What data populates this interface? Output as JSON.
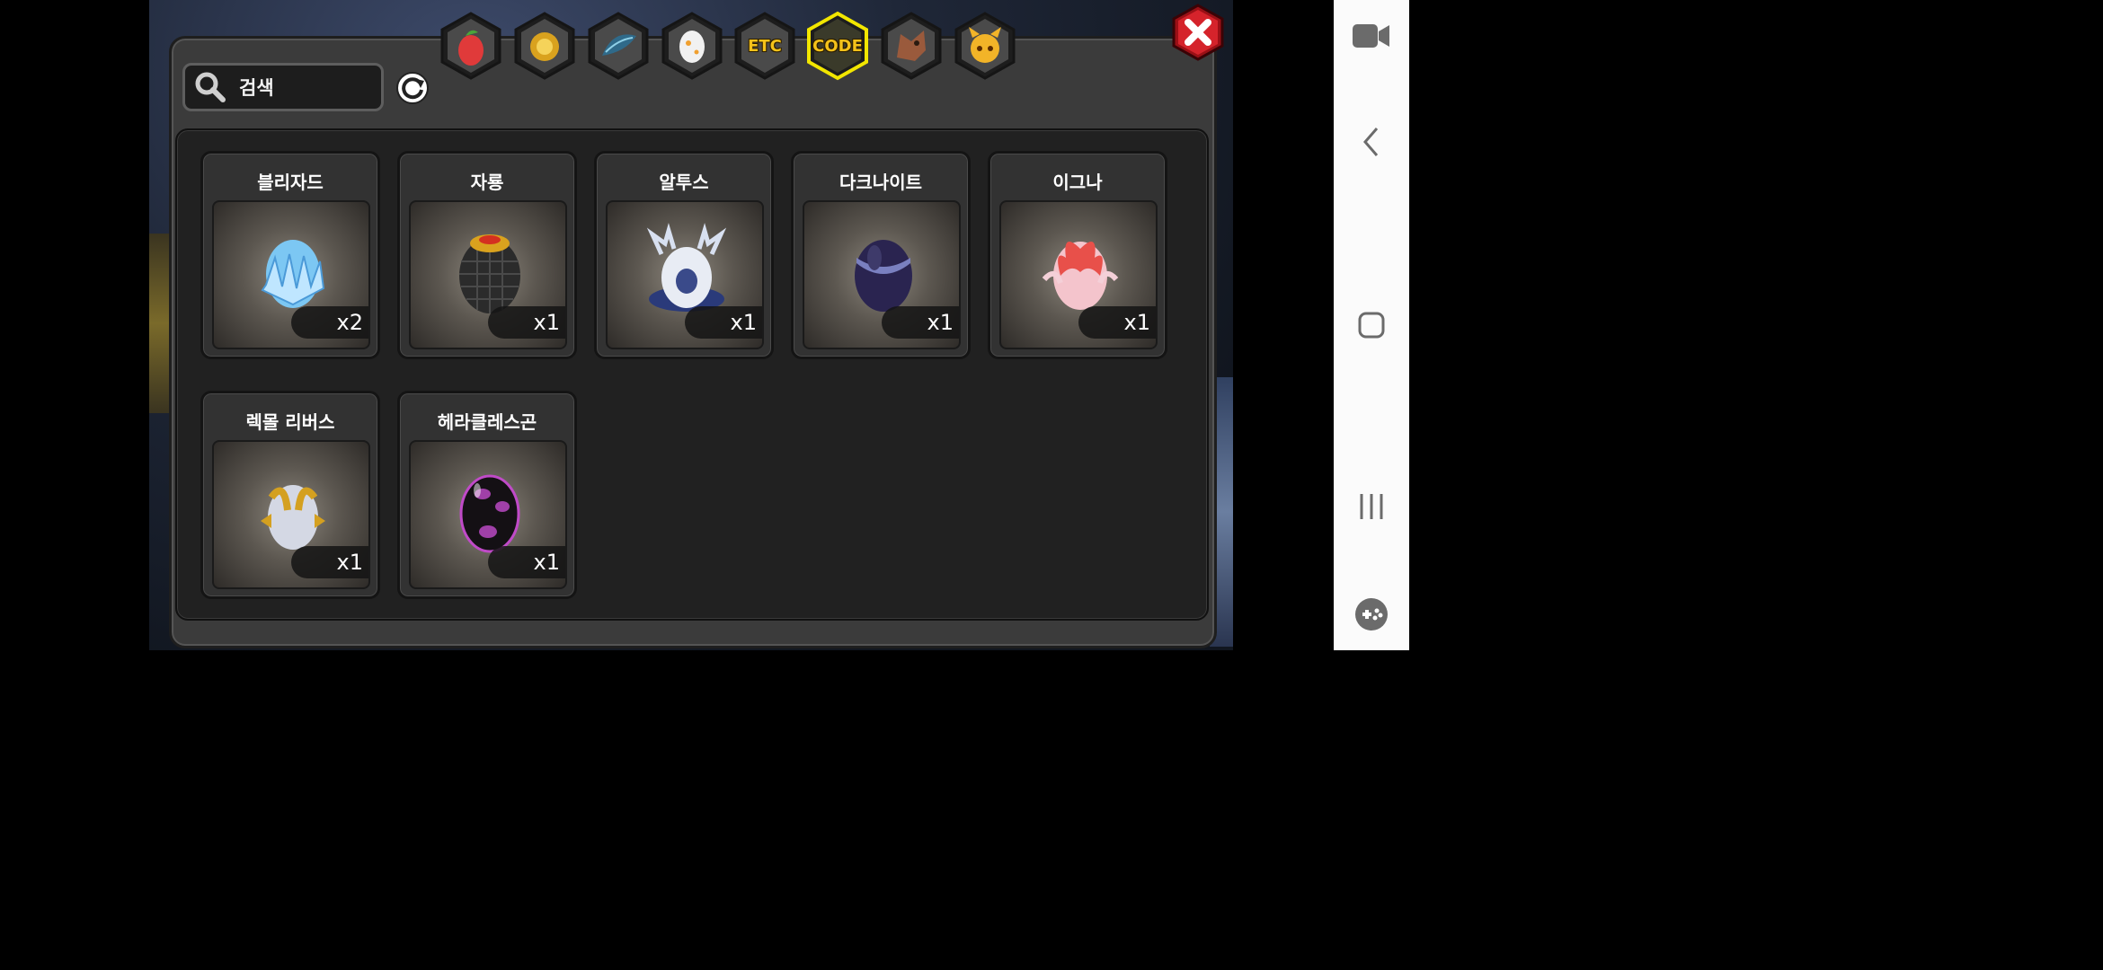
{
  "search": {
    "placeholder": "검색"
  },
  "tabs": [
    {
      "id": "fruit",
      "icon": "fruit-icon",
      "label": ""
    },
    {
      "id": "gold",
      "icon": "gold-orb-icon",
      "label": ""
    },
    {
      "id": "feather",
      "icon": "feather-icon",
      "label": ""
    },
    {
      "id": "egg",
      "icon": "egg-icon",
      "label": ""
    },
    {
      "id": "etc",
      "icon": "",
      "label": "ETC"
    },
    {
      "id": "code",
      "icon": "",
      "label": "CODE",
      "active": true
    },
    {
      "id": "dragon",
      "icon": "dragon-head-icon",
      "label": ""
    },
    {
      "id": "mascot",
      "icon": "mascot-icon",
      "label": ""
    }
  ],
  "eggs": [
    {
      "name": "블리자드",
      "count": "x2",
      "type": "crystal"
    },
    {
      "name": "자룡",
      "count": "x1",
      "type": "scaled"
    },
    {
      "name": "알투스",
      "count": "x1",
      "type": "silver"
    },
    {
      "name": "다크나이트",
      "count": "x1",
      "type": "dark"
    },
    {
      "name": "이그나",
      "count": "x1",
      "type": "flame"
    },
    {
      "name": "렉몰 리버스",
      "count": "x1",
      "type": "winged"
    },
    {
      "name": "헤라클레스곤",
      "count": "x1",
      "type": "spotted"
    }
  ],
  "colors": {
    "accent": "#f4c21a",
    "close": "#d5232b",
    "panel": "#3b3b3b"
  }
}
